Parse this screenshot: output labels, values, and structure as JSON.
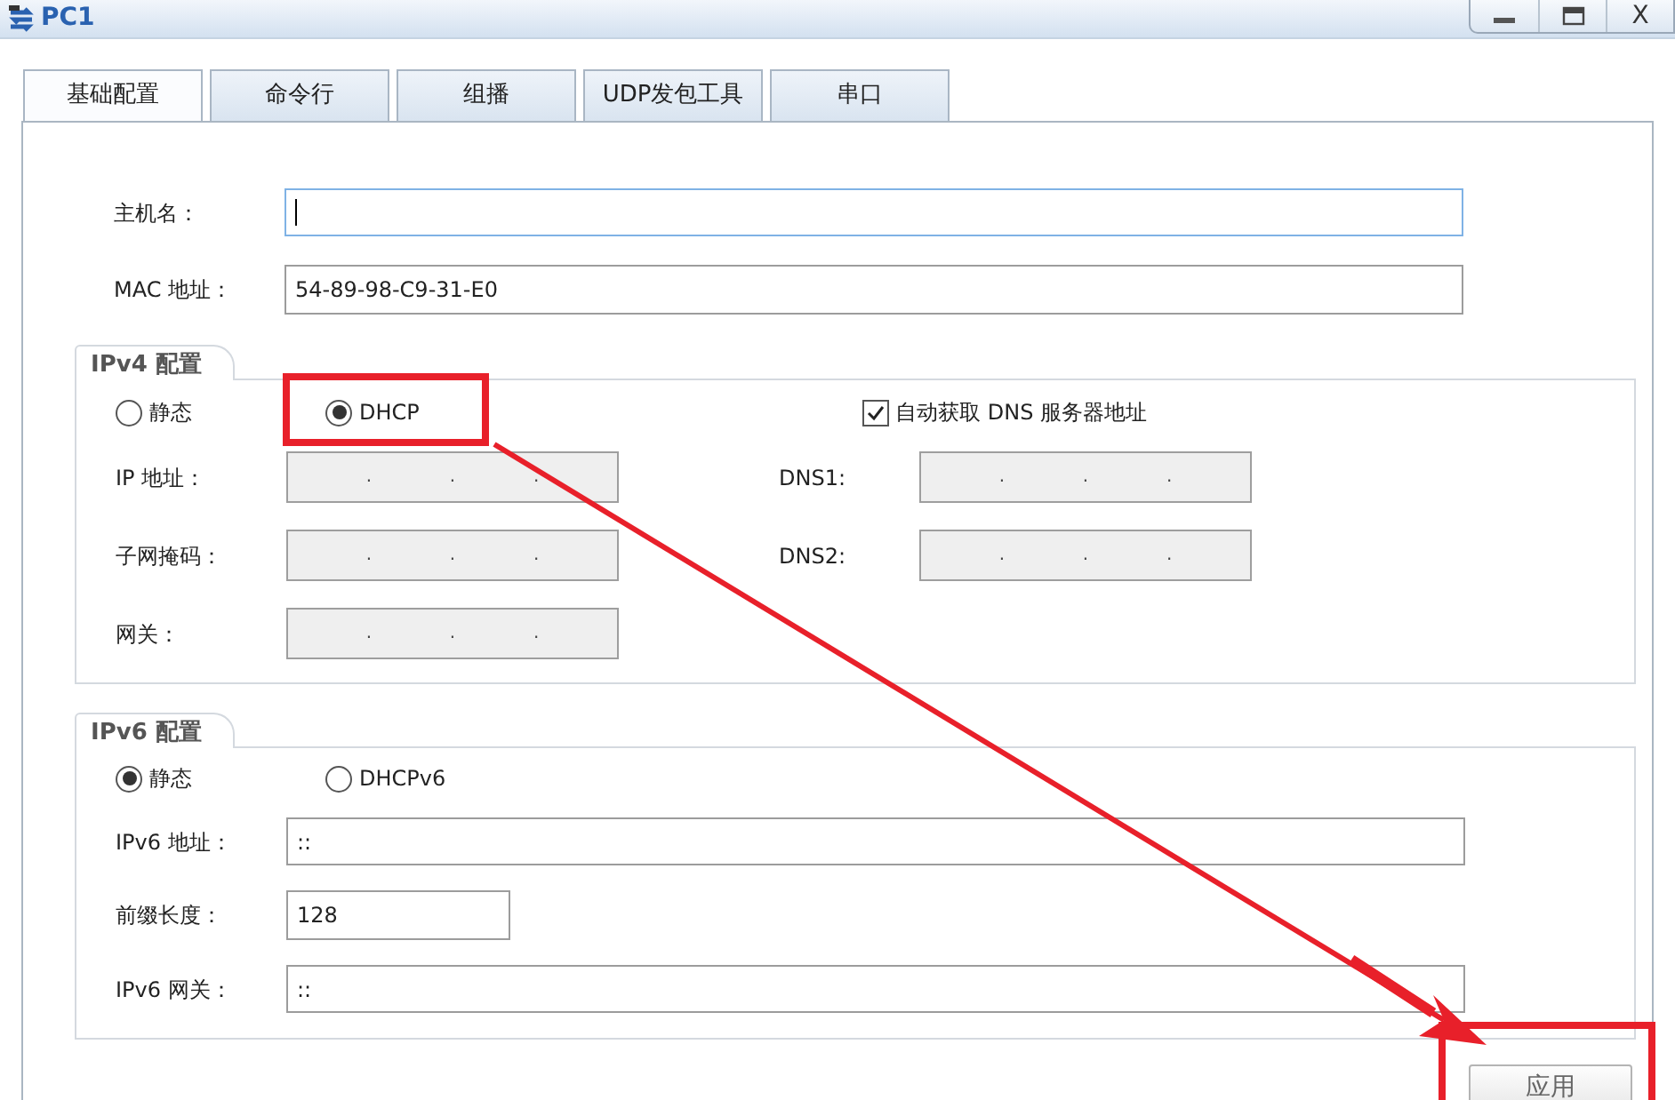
{
  "window": {
    "title": "PC1",
    "controls": [
      {
        "kind": "minimize"
      },
      {
        "kind": "maximize"
      },
      {
        "kind": "close",
        "label": "X"
      }
    ]
  },
  "tabs": [
    {
      "label": "基础配置",
      "selected": true
    },
    {
      "label": "命令行",
      "selected": false
    },
    {
      "label": "组播",
      "selected": false
    },
    {
      "label": "UDP发包工具",
      "selected": false
    },
    {
      "label": "串口",
      "selected": false
    }
  ],
  "host": {
    "label": "主机名：",
    "focused": true
  },
  "mac": {
    "label": "MAC 地址：",
    "value": "54-89-98-C9-31-E0"
  },
  "ipv4": {
    "title": "IPv4 配置",
    "modes": [
      {
        "label": "静态",
        "selected": false
      },
      {
        "label": "DHCP",
        "selected": true
      }
    ],
    "auto_dns": {
      "label": "自动获取 DNS 服务器地址",
      "checked": true
    },
    "fields": [
      {
        "label": "IP 地址：",
        "separators": [
          ".",
          ".",
          "."
        ],
        "disabled": true
      },
      {
        "label": "子网掩码：",
        "separators": [
          ".",
          ".",
          "."
        ],
        "disabled": true
      },
      {
        "label": "网关：",
        "separators": [
          ".",
          ".",
          "."
        ],
        "disabled": true
      }
    ],
    "dns_fields": [
      {
        "label": "DNS1:",
        "separators": [
          ".",
          ".",
          "."
        ],
        "disabled": true
      },
      {
        "label": "DNS2:",
        "separators": [
          ".",
          ".",
          "."
        ],
        "disabled": true
      }
    ]
  },
  "ipv6": {
    "title": "IPv6 配置",
    "modes": [
      {
        "label": "静态",
        "selected": true
      },
      {
        "label": "DHCPv6",
        "selected": false
      }
    ],
    "fields": [
      {
        "label": "IPv6 地址：",
        "value": "::",
        "kind": "wide"
      },
      {
        "label": "前缀长度：",
        "value": "128",
        "kind": "short"
      },
      {
        "label": "IPv6 网关：",
        "value": "::",
        "kind": "wide"
      }
    ]
  },
  "apply_button": {
    "label": "应用"
  },
  "annotations": [
    {
      "kind": "box"
    },
    {
      "kind": "box"
    },
    {
      "kind": "arrow"
    }
  ]
}
